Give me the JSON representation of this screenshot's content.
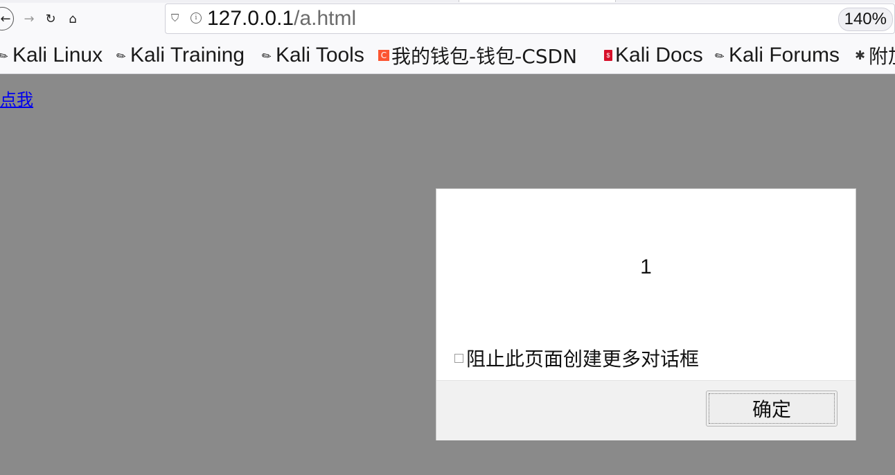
{
  "toolbar": {
    "url_host": "127.0.0.1",
    "url_path": "/a.html",
    "zoom": "140%"
  },
  "bookmarks": [
    {
      "label": "Kali Linux",
      "icon": "kali-dragon-icon"
    },
    {
      "label": "Kali Training",
      "icon": "kali-dragon-icon"
    },
    {
      "label": "Kali Tools",
      "icon": "kali-dragon-icon"
    },
    {
      "label": "我的钱包-钱包-CSDN",
      "icon": "csdn-icon"
    },
    {
      "label": "Kali Docs",
      "icon": "kali-docs-icon"
    },
    {
      "label": "Kali Forums",
      "icon": "kali-dragon-icon"
    },
    {
      "label": "附加",
      "icon": "puzzle-icon"
    }
  ],
  "page": {
    "link_text": "点我"
  },
  "dialog": {
    "message": "1",
    "checkbox_label": "阻止此页面创建更多对话框",
    "checkbox_checked": false,
    "ok_label": "确定"
  }
}
